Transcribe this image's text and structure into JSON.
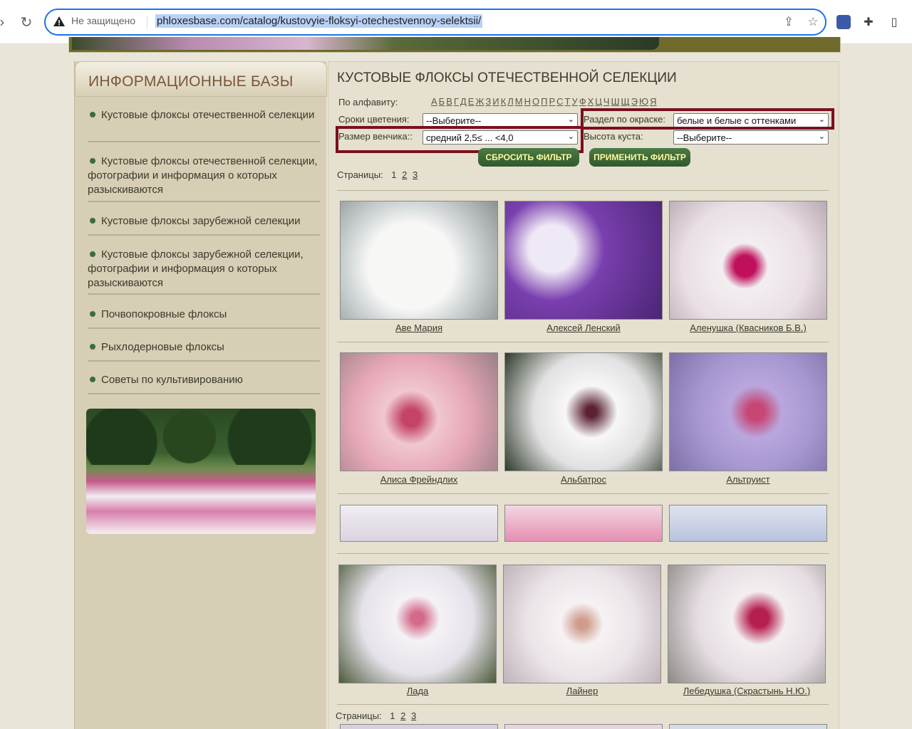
{
  "browser": {
    "security_label": "Не защищено",
    "url": "phloxesbase.com/catalog/kustovyie-floksyi-otechestvennoy-selektsii/"
  },
  "sidebar": {
    "title": "ИНФОРМАЦИОННЫЕ БАЗЫ",
    "items": [
      {
        "label": "Кустовые флоксы отечественной селекции"
      },
      {
        "label": "Кустовые флоксы отечественной селекции, фотографии и информация о которых разыскиваются"
      },
      {
        "label": "Кустовые флоксы зарубежной селекции"
      },
      {
        "label": "Кустовые флоксы зарубежной селекции, фотографии и информация о которых разыскиваются"
      },
      {
        "label": "Почвопокровные флоксы"
      },
      {
        "label": "Рыхлодерновые флоксы"
      },
      {
        "label": "Советы по культивированию"
      }
    ]
  },
  "main": {
    "title": "КУСТОВЫЕ ФЛОКСЫ ОТЕЧЕСТВЕННОЙ СЕЛЕКЦИИ",
    "alphabet_label": "По алфавиту:",
    "alphabet": [
      "А",
      "Б",
      "В",
      "Г",
      "Д",
      "Е",
      "Ж",
      "З",
      "И",
      "К",
      "Л",
      "М",
      "Н",
      "О",
      "П",
      "Р",
      "С",
      "Т",
      "У",
      "Ф",
      "Х",
      "Ц",
      "Ч",
      "Ш",
      "Щ",
      "Э",
      "Ю",
      "Я"
    ],
    "filters": {
      "bloom_label": "Сроки цветения:",
      "bloom_value": "--Выберите--",
      "color_label": "Раздел по окраске:",
      "color_value": "белые и белые с оттенками",
      "corolla_label": "Размер венчика::",
      "corolla_value": "средний 2,5≤ ... <4,0",
      "height_label": "Высота куста:",
      "height_value": "--Выберите--"
    },
    "reset_label": "СБРОСИТЬ ФИЛЬТР",
    "apply_label": "ПРИМЕНИТЬ ФИЛЬТР",
    "pages_label": "Страницы:",
    "pages": [
      "1",
      "2",
      "3"
    ],
    "cards": [
      {
        "name": "Аве Мария"
      },
      {
        "name": "Алексей Ленский"
      },
      {
        "name": "Аленушка (Квасников Б.В.)"
      },
      {
        "name": "Алиса Фрейндлих"
      },
      {
        "name": "Альбатрос"
      },
      {
        "name": "Альтруист"
      },
      {
        "name": "Лада"
      },
      {
        "name": "Лайнер"
      },
      {
        "name": "Лебедушка (Скрастынь Н.Ю.)"
      }
    ]
  },
  "colors": {
    "accent_highlight": "#7a0f1f",
    "button_bg": "#3e6b3a",
    "button_text": "#fff8a0"
  }
}
